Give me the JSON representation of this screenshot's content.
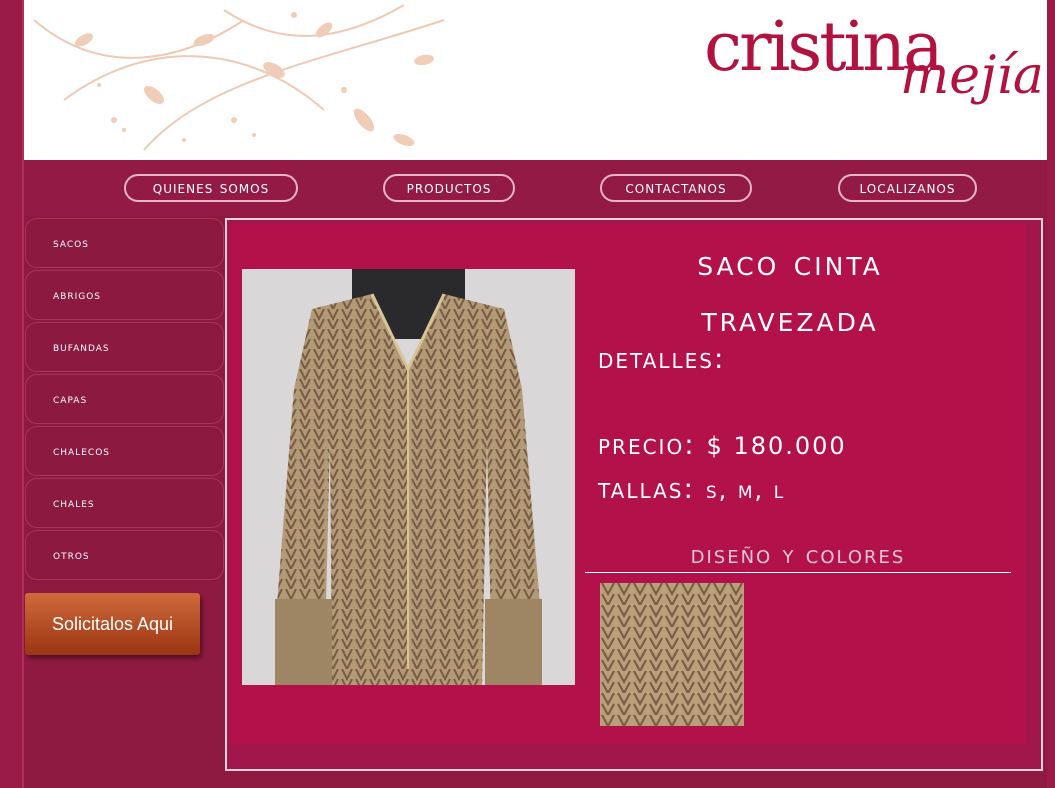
{
  "brand": {
    "logo_main": "cristina",
    "logo_sub": "mejía",
    "color": "#b1123f"
  },
  "nav": {
    "items": [
      {
        "label": "quienes somos"
      },
      {
        "label": "productos"
      },
      {
        "label": "contactanos"
      },
      {
        "label": "localizanos"
      }
    ]
  },
  "sidebar": {
    "items": [
      {
        "label": "sacos"
      },
      {
        "label": "abrigos"
      },
      {
        "label": "bufandas"
      },
      {
        "label": "capas"
      },
      {
        "label": "chalecos"
      },
      {
        "label": "chales"
      },
      {
        "label": "otros"
      }
    ],
    "cta_label": "Solicitalos Aqui"
  },
  "product": {
    "title_line1": "saco cinta",
    "title_line2": "travezada",
    "details_label": "detalles:",
    "price_label": "precio:",
    "price_value": "$ 180.000",
    "sizes_label": "tallas:",
    "sizes_value": "S, M, L",
    "design_label": "diseño y colores",
    "photo_icon": "knit-cardigan-image",
    "swatch_icon": "knit-texture-swatch"
  },
  "colors": {
    "page_bg": "#8e1a42",
    "panel": "#b3114a",
    "accent": "#e7b5c6"
  }
}
